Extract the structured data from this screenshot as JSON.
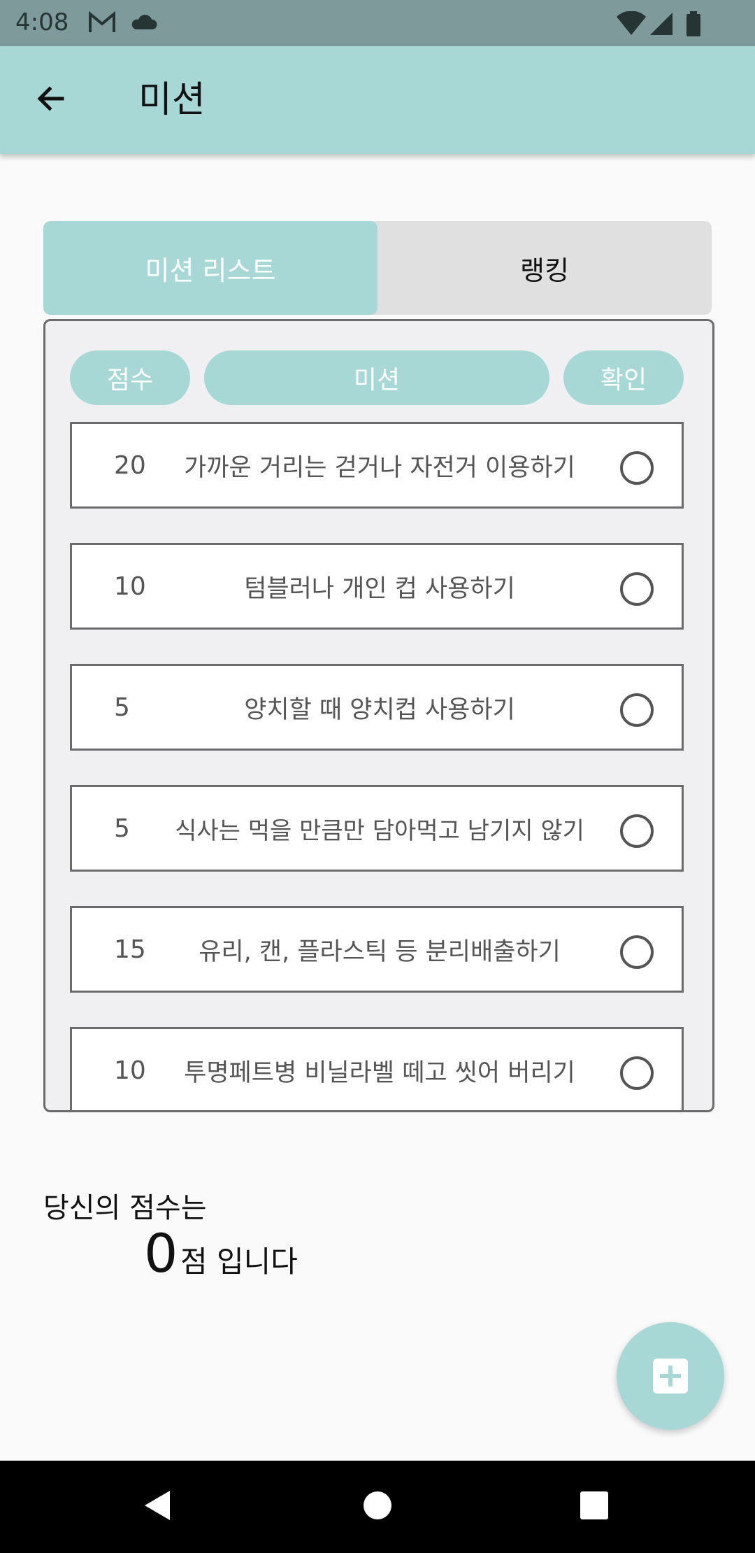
{
  "status_bar": {
    "time": "4:08",
    "icons": [
      "gmail-icon",
      "cloud-icon",
      "wifi-icon",
      "signal-icon",
      "battery-icon"
    ]
  },
  "app_bar": {
    "title": "미션",
    "back_icon": "arrow-left-icon"
  },
  "tabs": [
    {
      "label": "미션 리스트",
      "active": true
    },
    {
      "label": "랭킹",
      "active": false
    }
  ],
  "columns": {
    "score": "점수",
    "mission": "미션",
    "confirm": "확인"
  },
  "missions": [
    {
      "score": "20",
      "text": "가까운 거리는 걷거나 자전거 이용하기",
      "checked": false
    },
    {
      "score": "10",
      "text": "텀블러나 개인 컵 사용하기",
      "checked": false
    },
    {
      "score": "5",
      "text": "양치할 때 양치컵 사용하기",
      "checked": false
    },
    {
      "score": "5",
      "text": "식사는 먹을 만큼만 담아먹고 남기지 않기",
      "checked": false
    },
    {
      "score": "15",
      "text": "유리, 캔, 플라스틱 등 분리배출하기",
      "checked": false
    },
    {
      "score": "10",
      "text": "투명페트병 비닐라벨 떼고 씻어 버리기",
      "checked": false
    }
  ],
  "summary": {
    "label": "당신의 점수는",
    "value": "0",
    "suffix": "점 입니다"
  },
  "fab": {
    "icon": "add-icon"
  },
  "colors": {
    "accent": "#a8d8d5",
    "status_bar": "#7f9a9a",
    "tab_inactive": "#e0e0e0"
  }
}
